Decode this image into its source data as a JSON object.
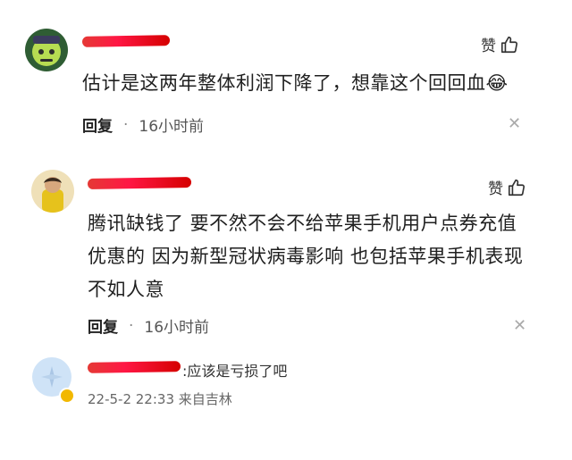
{
  "comments": [
    {
      "body": "估计是这两年整体利润下降了，想靠这个回回血😂",
      "like_label": "赞",
      "reply_label": "回复",
      "separator": "·",
      "time": "16小时前",
      "close": "✕"
    },
    {
      "body": "腾讯缺钱了 要不然不会不给苹果手机用户点券充值优惠的 因为新型冠状病毒影响 也包括苹果手机表现不如人意",
      "like_label": "赞",
      "reply_label": "回复",
      "separator": "·",
      "time": "16小时前",
      "close": "✕"
    }
  ],
  "sub_reply": {
    "text": ":应该是亏损了吧",
    "datetime": "22-5-2 22:33",
    "location": "来自吉林"
  }
}
